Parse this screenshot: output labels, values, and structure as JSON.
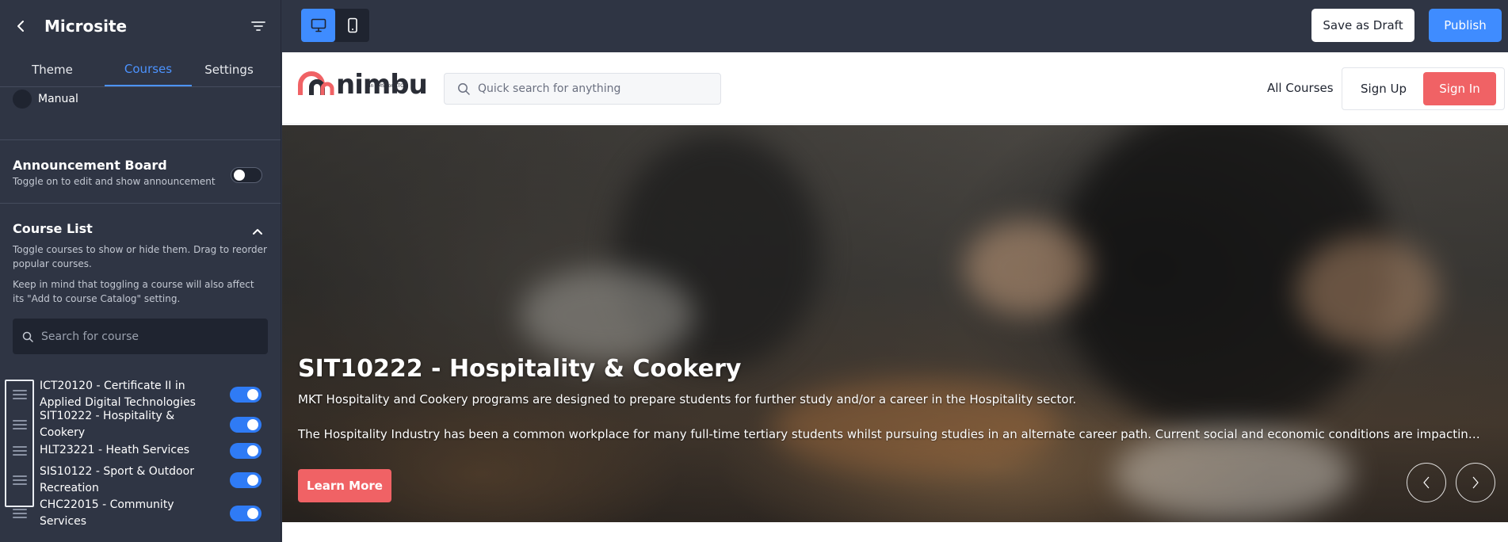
{
  "app": {
    "title": "Microsite",
    "tabs": [
      {
        "label": "Theme"
      },
      {
        "label": "Courses"
      },
      {
        "label": "Settings"
      }
    ]
  },
  "sidebar": {
    "manual_label": "Manual",
    "announcement": {
      "title": "Announcement Board",
      "description": "Toggle on to edit and show announcement",
      "enabled": false
    },
    "course_list": {
      "title": "Course List",
      "description": "Toggle courses to show or hide them. Drag to reorder popular courses.",
      "note": "Keep in mind that toggling a course will also affect its \"Add to course Catalog\" setting.",
      "search_placeholder": "Search for course",
      "courses": [
        {
          "name": "ICT20120 - Certificate II in Applied Digital Technologies",
          "enabled": true
        },
        {
          "name": "SIT10222 - Hospitality & Cookery",
          "enabled": true
        },
        {
          "name": "HLT23221 - Heath Services",
          "enabled": true
        },
        {
          "name": "SIS10122 - Sport & Outdoor Recreation",
          "enabled": true
        },
        {
          "name": "CHC22015 - Community Services",
          "enabled": true
        }
      ]
    }
  },
  "topbar": {
    "save_draft_label": "Save as Draft",
    "publish_label": "Publish",
    "active_device": "desktop"
  },
  "preview": {
    "logo_text": "nimbu",
    "logo_tagline": "an LMS for RTOs",
    "search_placeholder": "Quick search for anything",
    "nav_all_courses": "All Courses",
    "sign_up_label": "Sign Up",
    "sign_in_label": "Sign In",
    "hero": {
      "title": "SIT10222 - Hospitality & Cookery",
      "paragraph1": "MKT Hospitality and Cookery programs are designed to prepare students for further study and/or a career in the Hospitality sector.",
      "paragraph2": "The Hospitality Industry has been a common workplace for many full-time tertiary students whilst pursuing studies in an alternate career path. Current social and economic conditions are impacting...",
      "cta_label": "Learn More"
    }
  },
  "colors": {
    "sidebar_bg": "#2f3544",
    "accent_blue": "#3f8cff",
    "brand_coral": "#f06265"
  }
}
